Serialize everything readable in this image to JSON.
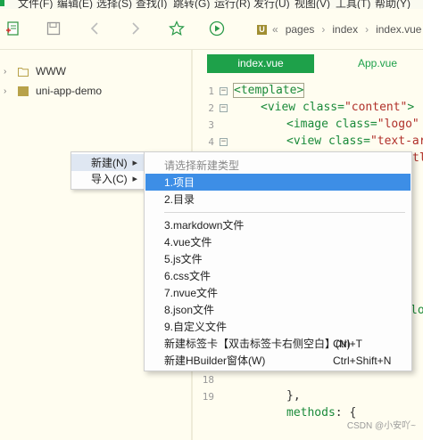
{
  "menubar": {
    "items": [
      "文件(F)",
      "编辑(E)",
      "选择(S)",
      "查找(I)",
      "跳转(G)",
      "运行(R)",
      "发行(U)",
      "视图(V)",
      "工具(T)",
      "帮助(Y)"
    ]
  },
  "toolbar": {
    "breadcrumb": [
      "pages",
      "index",
      "index.vue"
    ],
    "breadcrumb_icon": "U"
  },
  "tree": {
    "items": [
      {
        "label": "WWW",
        "icon": "folder-icon"
      },
      {
        "label": "uni-app-demo",
        "icon": "uniapp-project-icon"
      }
    ]
  },
  "editor": {
    "tabs": {
      "active": "index.vue",
      "inactive": "App.vue"
    },
    "line_numbers": [
      "1",
      "2",
      "3",
      "4",
      "18",
      "19"
    ],
    "code": {
      "l1_tag": "<template>",
      "l2_tag": "<view",
      "l2_attr": "class=",
      "l2_str": "\"content\"",
      "l2_end": ">",
      "l3_tag": "<image",
      "l3_attr": "class=",
      "l3_str": "\"logo\"",
      "l3_tail": " s",
      "l4_tag": "<view",
      "l4_attr": "class=",
      "l4_str": "\"text-are",
      "l5_frag": "tl",
      "l11_frag": "lo",
      "l18": "},",
      "l19_kw": "methods",
      "l19_rest": ": {"
    }
  },
  "context_menu": {
    "items": [
      {
        "label": "新建(N)",
        "submenu": true
      },
      {
        "label": "导入(C)",
        "submenu": true
      }
    ]
  },
  "submenu": {
    "header": "请选择新建类型",
    "items": [
      {
        "label": "1.项目",
        "shortcut": ""
      },
      {
        "label": "2.目录",
        "shortcut": ""
      },
      {
        "label": "3.markdown文件",
        "shortcut": ""
      },
      {
        "label": "4.vue文件",
        "shortcut": ""
      },
      {
        "label": "5.js文件",
        "shortcut": ""
      },
      {
        "label": "6.css文件",
        "shortcut": ""
      },
      {
        "label": "7.nvue文件",
        "shortcut": ""
      },
      {
        "label": "8.json文件",
        "shortcut": ""
      },
      {
        "label": "9.自定义文件",
        "shortcut": ""
      },
      {
        "label": "新建标签卡【双击标签卡右侧空白】(N)",
        "shortcut": "Ctrl+T"
      },
      {
        "label": "新建HBuilder窗体(W)",
        "shortcut": "Ctrl+Shift+N"
      }
    ]
  },
  "watermark": "CSDN @小安吖~",
  "colors": {
    "accent": "#1ea14a",
    "selection": "#3d8ee6",
    "background": "#fffdf0"
  }
}
